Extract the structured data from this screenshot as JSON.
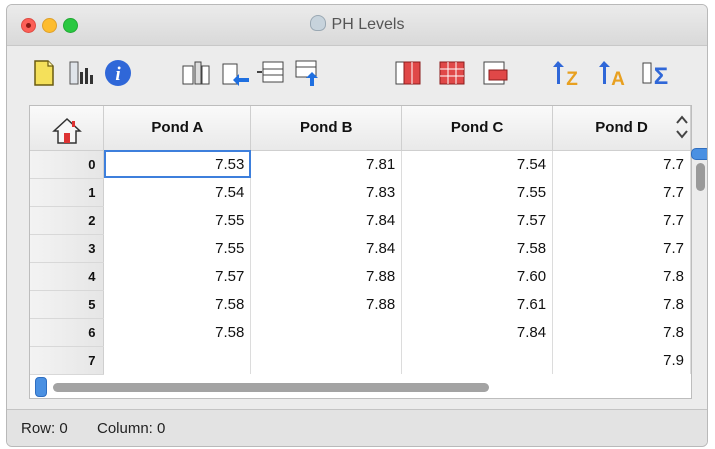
{
  "window": {
    "title": "PH Levels",
    "title_icon": "app-icon"
  },
  "toolbar": {
    "buttons": [
      {
        "name": "new-icon"
      },
      {
        "name": "chart-icon"
      },
      {
        "name": "info-icon"
      },
      {
        "name": "insert-column-icon"
      },
      {
        "name": "move-column-left-icon"
      },
      {
        "name": "insert-row-icon"
      },
      {
        "name": "move-row-down-icon"
      },
      {
        "name": "select-columns-icon"
      },
      {
        "name": "select-grid-icon"
      },
      {
        "name": "select-rows-icon"
      },
      {
        "name": "sort-z-icon"
      },
      {
        "name": "sort-a-icon"
      },
      {
        "name": "sum-icon"
      }
    ]
  },
  "table": {
    "corner_icon": "home-icon",
    "columns": [
      "Pond A",
      "Pond B",
      "Pond C",
      "Pond D"
    ],
    "rows": [
      {
        "index": "0",
        "cells": [
          "7.53",
          "7.81",
          "7.54",
          "7.7"
        ]
      },
      {
        "index": "1",
        "cells": [
          "7.54",
          "7.83",
          "7.55",
          "7.7"
        ]
      },
      {
        "index": "2",
        "cells": [
          "7.55",
          "7.84",
          "7.57",
          "7.7"
        ]
      },
      {
        "index": "3",
        "cells": [
          "7.55",
          "7.84",
          "7.58",
          "7.7"
        ]
      },
      {
        "index": "4",
        "cells": [
          "7.57",
          "7.88",
          "7.60",
          "7.8"
        ]
      },
      {
        "index": "5",
        "cells": [
          "7.58",
          "7.88",
          "7.61",
          "7.8"
        ]
      },
      {
        "index": "6",
        "cells": [
          "7.58",
          "",
          "7.84",
          "7.8"
        ]
      },
      {
        "index": "7",
        "cells": [
          "",
          "",
          "",
          "7.9"
        ]
      }
    ],
    "selected_cell": {
      "row": 0,
      "column": 0
    }
  },
  "status": {
    "row_label": "Row: 0",
    "column_label": "Column: 0"
  },
  "colors": {
    "selection": "#3d7fdc",
    "scroll_handle": "#4a90e2"
  }
}
